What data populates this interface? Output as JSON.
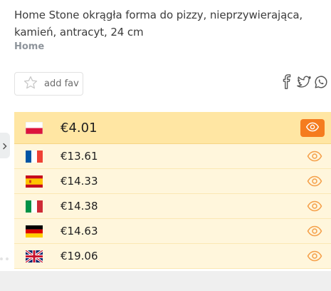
{
  "product": {
    "title": "Home Stone okrągła forma do pizzy, nieprzywierająca, kamień, antracyt, 24 cm",
    "brand": "Home"
  },
  "actions": {
    "fav_label": "add fav",
    "share_icons": [
      "facebook-icon",
      "twitter-icon",
      "whatsapp-icon"
    ]
  },
  "prices": [
    {
      "country": "Poland",
      "flag": "pl",
      "price": "€4.01",
      "best": true
    },
    {
      "country": "France",
      "flag": "fr",
      "price": "€13.61",
      "best": false
    },
    {
      "country": "Spain",
      "flag": "es",
      "price": "€14.33",
      "best": false
    },
    {
      "country": "Italy",
      "flag": "it",
      "price": "€14.38",
      "best": false
    },
    {
      "country": "Germany",
      "flag": "de",
      "price": "€14.63",
      "best": false
    },
    {
      "country": "United Kingdom",
      "flag": "gb",
      "price": "€19.06",
      "best": false
    }
  ],
  "colors": {
    "accent": "#f57c1f",
    "best_row": "#ffe6a3",
    "row": "#fff6dc",
    "brand_text": "#8e949b"
  }
}
